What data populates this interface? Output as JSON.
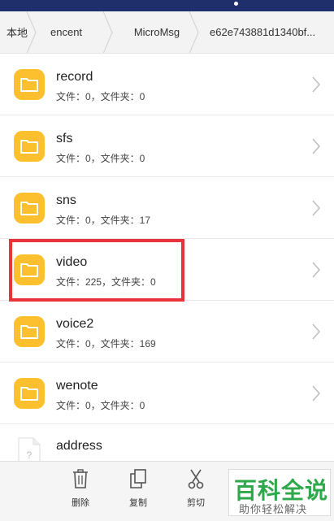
{
  "breadcrumb": {
    "items": [
      "本地",
      "encent",
      "MicroMsg",
      "e62e743881d1340bf..."
    ]
  },
  "folders": [
    {
      "name": "record",
      "meta": "文件：0，文件夹：0"
    },
    {
      "name": "sfs",
      "meta": "文件：0，文件夹：0"
    },
    {
      "name": "sns",
      "meta": "文件：0，文件夹：17"
    },
    {
      "name": "video",
      "meta": "文件：225，文件夹：0"
    },
    {
      "name": "voice2",
      "meta": "文件：0，文件夹：169"
    },
    {
      "name": "wenote",
      "meta": "文件：0，文件夹：0"
    }
  ],
  "file": {
    "name": "address",
    "icon": "unknown-file-icon"
  },
  "highlighted_item": "video",
  "toolbar": {
    "delete_label": "删除",
    "copy_label": "复制",
    "cut_label": "剪切"
  },
  "watermark": {
    "title": "百科全说",
    "subtitle": "助你轻松解决"
  },
  "colors": {
    "status_bar": "#1f2f6b",
    "folder_icon": "#fcc02e",
    "highlight_box": "#e8323c",
    "watermark_green": "#2ea84a"
  }
}
